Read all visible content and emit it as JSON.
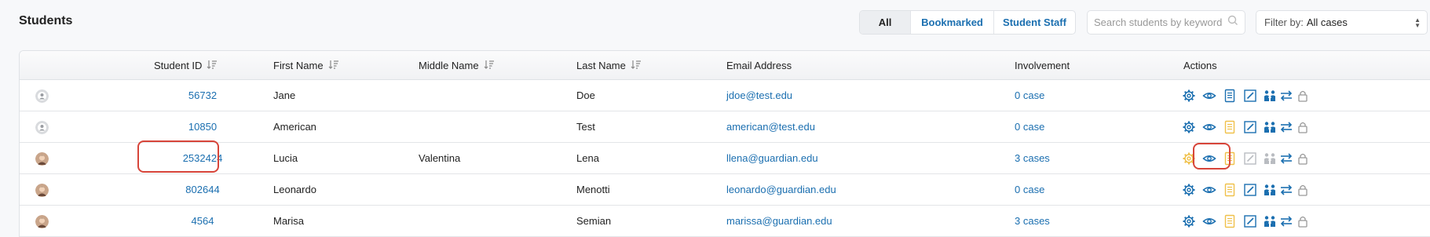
{
  "page": {
    "title": "Students"
  },
  "tabs": [
    {
      "label": "All",
      "active": true
    },
    {
      "label": "Bookmarked",
      "active": false
    },
    {
      "label": "Student Staff",
      "active": false
    }
  ],
  "search": {
    "placeholder": "Search students by keyword",
    "value": ""
  },
  "filter": {
    "label": "Filter by:",
    "value": "All cases"
  },
  "table": {
    "columns": {
      "student_id": "Student ID",
      "first_name": "First Name",
      "middle_name": "Middle Name",
      "last_name": "Last Name",
      "email": "Email Address",
      "involvement": "Involvement",
      "actions": "Actions"
    },
    "rows": [
      {
        "avatar": "default-avatar",
        "student_id": "56732",
        "first_name": "Jane",
        "middle_name": "",
        "last_name": "Doe",
        "email": "jdoe@test.edu",
        "involvement": "0 case",
        "highlight_id": false,
        "highlight_view": false
      },
      {
        "avatar": "default-avatar",
        "student_id": "10850",
        "first_name": "American",
        "middle_name": "",
        "last_name": "Test",
        "email": "american@test.edu",
        "involvement": "0 case",
        "highlight_id": false,
        "highlight_view": false
      },
      {
        "avatar": "photo-avatar",
        "student_id": "2532424",
        "first_name": "Lucia",
        "middle_name": "Valentina",
        "last_name": "Lena",
        "email": "llena@guardian.edu",
        "involvement": "3 cases",
        "highlight_id": true,
        "highlight_view": true
      },
      {
        "avatar": "photo-avatar",
        "student_id": "802644",
        "first_name": "Leonardo",
        "middle_name": "",
        "last_name": "Menotti",
        "email": "leonardo@guardian.edu",
        "involvement": "0 case",
        "highlight_id": false,
        "highlight_view": false
      },
      {
        "avatar": "photo-avatar",
        "student_id": "4564",
        "first_name": "Marisa",
        "middle_name": "",
        "last_name": "Semian",
        "email": "marissa@guardian.edu",
        "involvement": "3 cases",
        "highlight_id": false,
        "highlight_view": false
      }
    ]
  },
  "actions": [
    "gear-icon",
    "eye-icon",
    "notes-icon",
    "edit-icon",
    "people-icon",
    "transfer-icon",
    "lock-icon"
  ],
  "colors": {
    "link": "#1b6fb0",
    "highlight": "#d7453a",
    "note_active": "#f0c14b"
  }
}
